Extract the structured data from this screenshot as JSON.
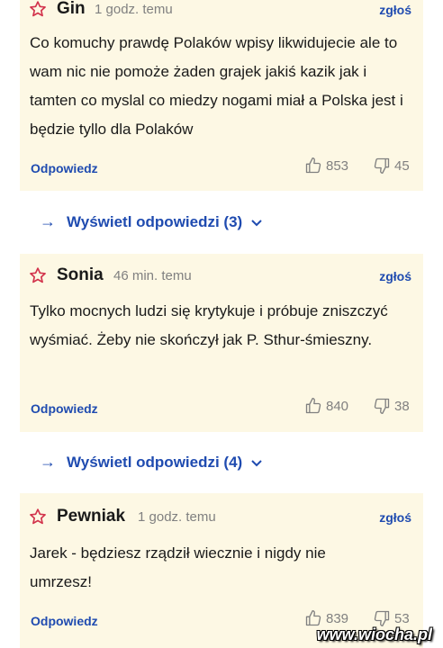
{
  "colors": {
    "card_bg": "#fdf8e4",
    "accent": "#1f4bb0",
    "star": "#d2324b",
    "muted": "#808080"
  },
  "comments": [
    {
      "author": "Gin",
      "time": "1 godz. temu",
      "report": "zgłoś",
      "text": "Co komuchy prawdę Polaków wpisy likwidujecie ale to wam nic nie pomoże żaden grajek jakiś kazik jak i tamten co myslal co miedzy nogami miał a Polska jest i będzie tyllo dla Polaków",
      "reply": "Odpowiedz",
      "likes": "853",
      "dislikes": "45",
      "show_replies": "Wyświetl odpowiedzi (3)"
    },
    {
      "author": "Sonia",
      "time": "46 min. temu",
      "report": "zgłoś",
      "text": "Tylko mocnych ludzi się krytykuje i próbuje zniszczyć wyśmiać. Żeby nie skończył jak P. Sthur-śmieszny.",
      "reply": "Odpowiedz",
      "likes": "840",
      "dislikes": "38",
      "show_replies": "Wyświetl odpowiedzi (4)"
    },
    {
      "author": "Pewniak",
      "time": "1 godz. temu",
      "report": "zgłoś",
      "text": "Jarek - będziesz rządził wiecznie i nigdy nie umrzesz!",
      "reply": "Odpowiedz",
      "likes": "839",
      "dislikes": "53"
    }
  ],
  "watermark": "www.wiocha.pl"
}
